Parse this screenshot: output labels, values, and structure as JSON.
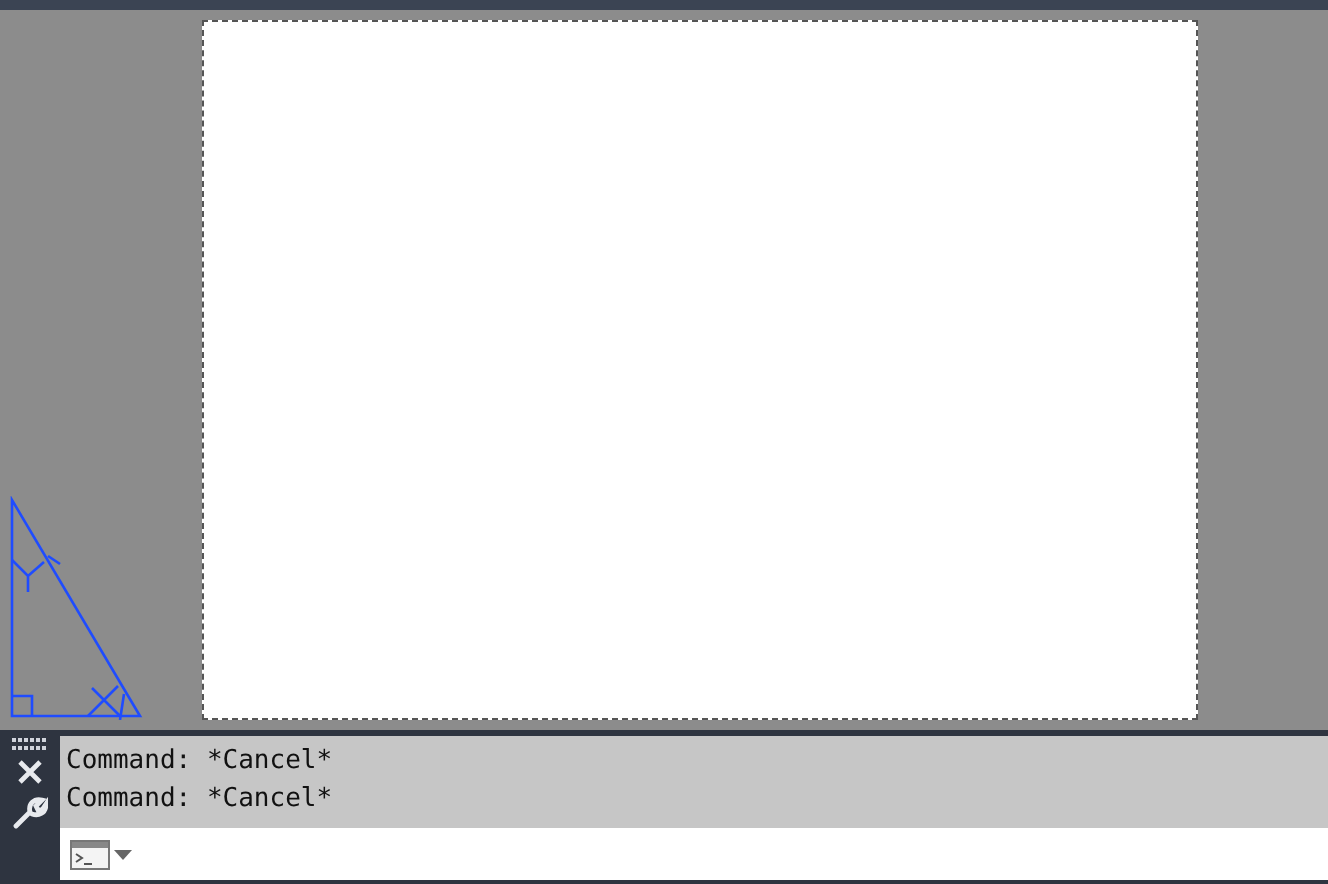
{
  "command_line": {
    "history": [
      "Command: *Cancel*",
      "Command: *Cancel*"
    ]
  }
}
